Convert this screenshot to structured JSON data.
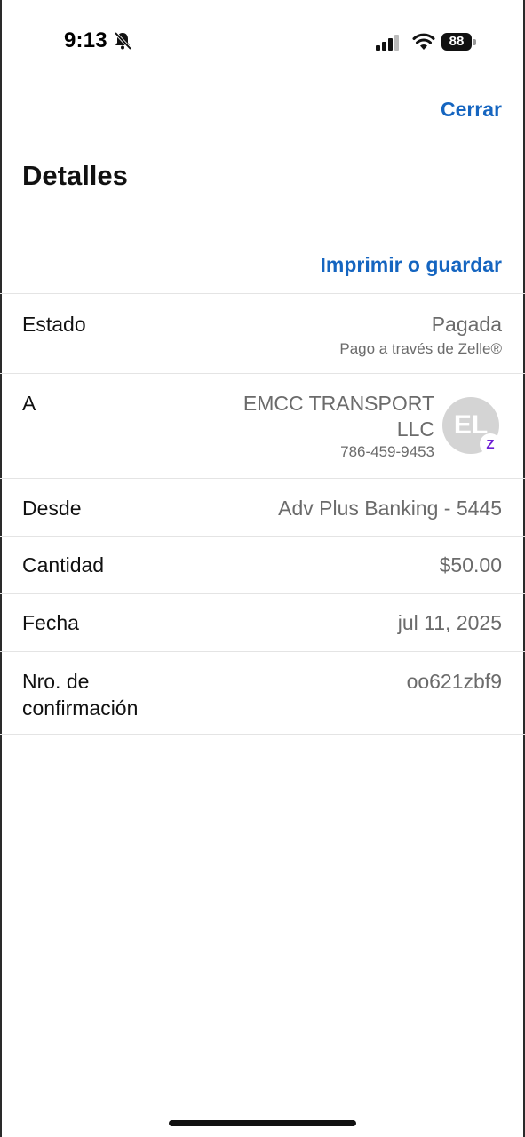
{
  "status_bar": {
    "time": "9:13",
    "battery": "88"
  },
  "header": {
    "close_label": "Cerrar",
    "title": "Detalles",
    "print_label": "Imprimir o guardar"
  },
  "details": {
    "estado": {
      "label": "Estado",
      "value": "Pagada",
      "sub": "Pago a través de Zelle®"
    },
    "to": {
      "label": "A",
      "name_line1": "EMCC TRANSPORT",
      "name_line2": "LLC",
      "phone": "786-459-9453",
      "avatar_initials": "EL",
      "badge": "Z"
    },
    "from": {
      "label": "Desde",
      "value": "Adv Plus Banking - 5445"
    },
    "amount": {
      "label": "Cantidad",
      "value": "$50.00"
    },
    "date": {
      "label": "Fecha",
      "value": "jul 11, 2025"
    },
    "confirmation": {
      "label_line1": "Nro. de",
      "label_line2": "confirmación",
      "value": "oo621zbf9"
    }
  },
  "colors": {
    "accent": "#1565c0",
    "zelle": "#6d1ed4"
  }
}
